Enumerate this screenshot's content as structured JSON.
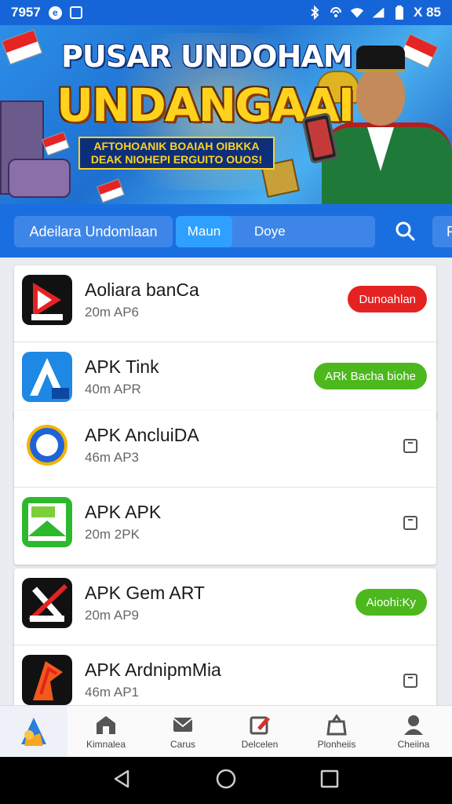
{
  "status_bar": {
    "time": "7957",
    "right_text": "X 85",
    "icons": [
      "app-icon",
      "image-icon",
      "bluetooth-icon",
      "nfc-icon",
      "wifi-icon",
      "signal-icon",
      "battery-icon"
    ]
  },
  "banner": {
    "title_line1": "PUSAR UNDOHAM",
    "title_line2": "UNDANGAAI",
    "subtitle_line1": "AFTOHOANIK BOAIAH OIBKKA",
    "subtitle_line2": "DEAK NIOHEPI ERGUITO OUOS!"
  },
  "toolbar": {
    "title": "Adeilara Undomlaan",
    "tabs": [
      {
        "label": "Maun",
        "active": true
      },
      {
        "label": "Doye",
        "active": false
      }
    ],
    "more_label": "P"
  },
  "apps": [
    {
      "name": "Aoliara banCa",
      "size": "20m AP6",
      "action": "button",
      "action_label": "Dunoahlan",
      "action_color": "#e52222",
      "icon": "apk-red-arrow-icon"
    },
    {
      "name": "APK Tink",
      "size": "40m APR",
      "action": "button",
      "action_label": "ARk Bacha biohe",
      "action_color": "#4cb81e",
      "icon": "apk-blue-a-icon"
    },
    {
      "name": "APK  AncluiDA",
      "size": "46m AP3",
      "action": "checkbox",
      "icon": "circle-logo-icon"
    },
    {
      "name": "APK APK",
      "size": "20m 2PK",
      "action": "checkbox",
      "icon": "green-map-icon"
    },
    {
      "name": "APK Gem ART",
      "size": "20m AP9",
      "action": "button",
      "action_label": "Aioohi:Ky",
      "action_color": "#4cb81e",
      "icon": "black-slash-icon"
    },
    {
      "name": "APK ArdnipmMia",
      "size": "46m AP1",
      "action": "checkbox",
      "icon": "orange-p-icon"
    }
  ],
  "bottom_nav": [
    {
      "label": "",
      "icon": "app-logo-icon"
    },
    {
      "label": "Kimnalea",
      "icon": "store-icon"
    },
    {
      "label": "Carus",
      "icon": "mail-icon"
    },
    {
      "label": "Delcelen",
      "icon": "edit-icon"
    },
    {
      "label": "Plonheiis",
      "icon": "bag-icon"
    },
    {
      "label": "Cheiina",
      "icon": "profile-icon"
    }
  ]
}
